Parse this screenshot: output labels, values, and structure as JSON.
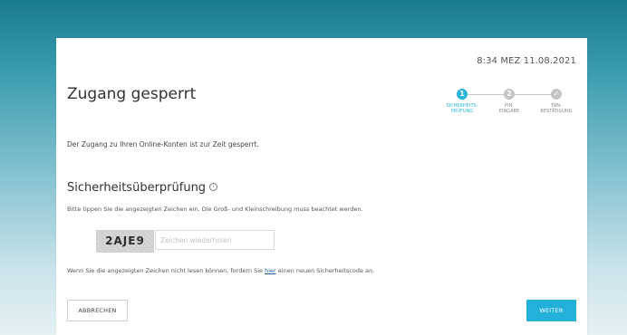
{
  "header": {
    "timestamp": "8:34 MEZ 11.08.2021",
    "title": "Zugang gesperrt"
  },
  "stepper": {
    "steps": [
      {
        "number": "1",
        "label_line1": "SICHERHEITS-",
        "label_line2": "PRÜFUNG",
        "state": "active"
      },
      {
        "number": "2",
        "label_line1": "PIN-",
        "label_line2": "EINGABE",
        "state": "inactive"
      },
      {
        "number": "✓",
        "label_line1": "TAN-",
        "label_line2": "BESTÄTIGUNG",
        "state": "inactive"
      }
    ]
  },
  "main": {
    "intro": "Der Zugang zu Ihren Online-Konten ist zur Zeit gesperrt.",
    "section_title": "Sicherheitsüberprüfung",
    "info_icon_glyph": "i",
    "instruction": "Bitte tippen Sie die angezeigten Zeichen ein. Die Groß- und Kleinschreibung muss beachtet werden.",
    "captcha_text": "2AJE9",
    "captcha_input": {
      "value": "",
      "placeholder": "Zeichen wiederholen"
    },
    "new_code_prefix": "Wenn Sie die angezeigten Zeichen nicht lesen können, fordern Sie ",
    "new_code_link": "hier",
    "new_code_suffix": " einen neuen Sicherheitscode an."
  },
  "buttons": {
    "cancel": "ABBRECHEN",
    "next": "WEITER"
  },
  "colors": {
    "accent": "#23b1d9",
    "link": "#1a5c9e",
    "inactive_step": "#c4c4c4"
  }
}
